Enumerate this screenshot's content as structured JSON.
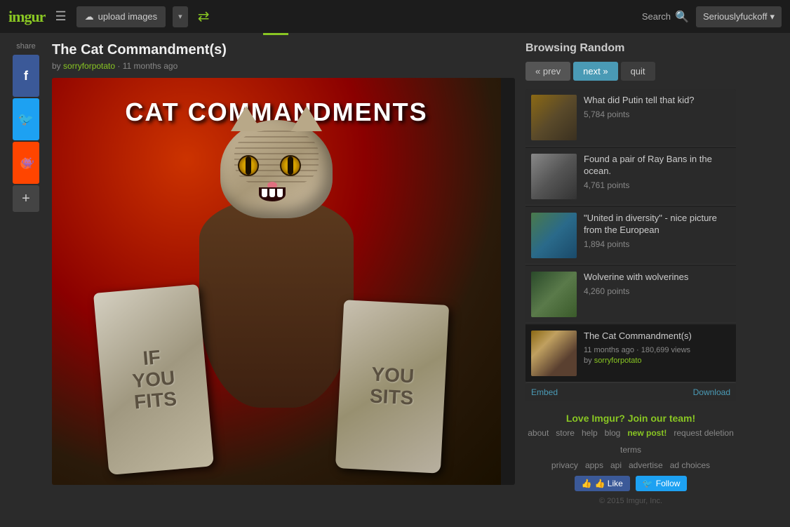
{
  "header": {
    "logo": "imgur",
    "upload_label": "upload images",
    "search_label": "Search",
    "user_label": "Seriouslyfuckoff",
    "shuffle_label": "✕"
  },
  "share": {
    "label": "share",
    "facebook_label": "f",
    "twitter_label": "🐦",
    "reddit_label": "👾",
    "more_label": "+"
  },
  "post": {
    "title": "The Cat Commandment(s)",
    "meta_by": "by",
    "author": "sorryforpotato",
    "separator": "·",
    "timestamp": "11 months ago",
    "title_text": "CAT COMMANDMENTS",
    "tablet_left_line1": "IF",
    "tablet_left_line2": "YOU",
    "tablet_left_line3": "FITS",
    "tablet_right_line1": "YOU",
    "tablet_right_line2": "SITS"
  },
  "browsing_panel": {
    "title": "Browsing Random",
    "prev_label": "« prev",
    "next_label": "next »",
    "quit_label": "quit",
    "items": [
      {
        "title": "What did Putin tell that kid?",
        "points": "5,784 points",
        "thumb_class": "thumb-1"
      },
      {
        "title": "Found a pair of Ray Bans in the ocean.",
        "points": "4,761 points",
        "thumb_class": "thumb-2"
      },
      {
        "title": "\"United in diversity\" - nice picture from the European",
        "points": "1,894 points",
        "thumb_class": "thumb-3"
      },
      {
        "title": "Wolverine with wolverines",
        "points": "4,260 points",
        "thumb_class": "thumb-4"
      },
      {
        "title": "The Cat Commandment(s)",
        "meta": "11 months ago · 180,699 views",
        "meta_by": "by",
        "author": "sorryforpotato",
        "thumb_class": "thumb-5"
      }
    ],
    "embed_label": "Embed",
    "download_label": "Download"
  },
  "footer": {
    "cta": "Love Imgur? Join our team!",
    "links": [
      {
        "label": "about",
        "href": "#"
      },
      {
        "label": "store",
        "href": "#"
      },
      {
        "label": "help",
        "href": "#"
      },
      {
        "label": "blog",
        "href": "#"
      },
      {
        "label": "new post!",
        "href": "#",
        "class": "new-post"
      },
      {
        "label": "request deletion",
        "href": "#"
      },
      {
        "label": "terms",
        "href": "#"
      },
      {
        "label": "privacy",
        "href": "#"
      },
      {
        "label": "apps",
        "href": "#"
      },
      {
        "label": "api",
        "href": "#"
      },
      {
        "label": "advertise",
        "href": "#"
      },
      {
        "label": "ad choices",
        "href": "#"
      }
    ],
    "fb_like": "👍 Like",
    "tw_follow": "Follow",
    "copyright": "© 2015 Imgur, Inc."
  }
}
